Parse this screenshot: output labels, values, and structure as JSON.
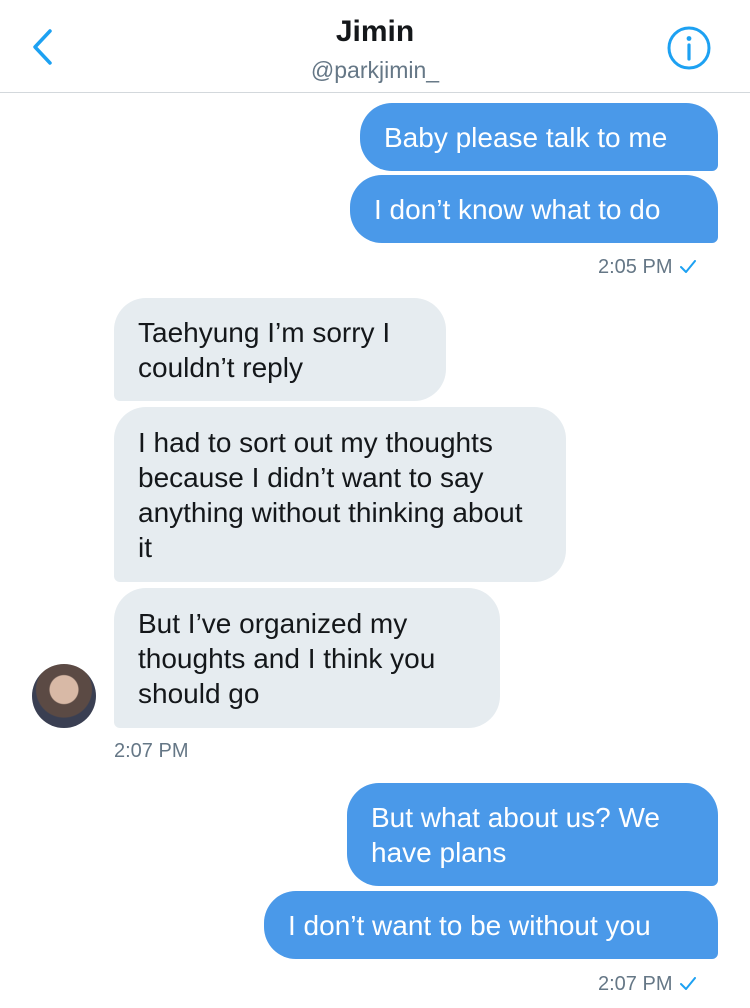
{
  "header": {
    "title": "Jimin",
    "handle": "@parkjimin_"
  },
  "colors": {
    "accent": "#1da1f2",
    "outgoing_bubble": "#4a99e9",
    "incoming_bubble": "#e6ecf0"
  },
  "messages": [
    {
      "direction": "outgoing",
      "text": "Baby please talk to me"
    },
    {
      "direction": "outgoing",
      "text": "I don’t know what to do"
    },
    {
      "direction": "outgoing",
      "time": "2:05 PM",
      "read": true
    },
    {
      "direction": "incoming",
      "text": "Taehyung I’m sorry I couldn’t reply"
    },
    {
      "direction": "incoming",
      "text": "I had to sort out my thoughts because I didn’t want to say anything without thinking about it"
    },
    {
      "direction": "incoming",
      "text": "But I’ve organized my thoughts and I think you should go"
    },
    {
      "direction": "incoming",
      "time": "2:07 PM"
    },
    {
      "direction": "outgoing",
      "text": "But what about us? We have plans"
    },
    {
      "direction": "outgoing",
      "text": "I don’t want to be without you"
    },
    {
      "direction": "outgoing",
      "time": "2:07 PM",
      "read": true
    }
  ],
  "icons": {
    "back": "chevron-left-icon",
    "info": "info-icon",
    "read_receipt": "checkmark-icon"
  }
}
